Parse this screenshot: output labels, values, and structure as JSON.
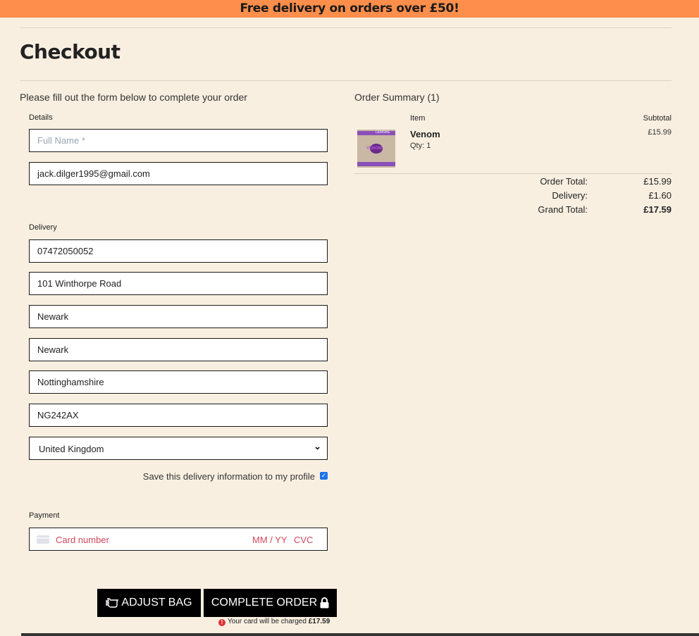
{
  "banner": {
    "text": "Free delivery on orders over £50!"
  },
  "page": {
    "title": "Checkout",
    "intro": "Please fill out the form below to complete your order"
  },
  "details": {
    "label": "Details",
    "full_name": {
      "value": "",
      "placeholder": "Full Name *"
    },
    "email": {
      "value": "jack.dilger1995@gmail.com"
    }
  },
  "delivery": {
    "label": "Delivery",
    "phone": "07472050052",
    "street": "101 Winthorpe Road",
    "town": "Newark",
    "city": "Newark",
    "county": "Nottinghamshire",
    "postcode": "NG242AX",
    "country": "United Kingdom",
    "save_label": "Save this delivery information to my profile",
    "save_checked": true
  },
  "payment": {
    "label": "Payment",
    "card_placeholder": "Card number",
    "expiry_placeholder": "MM / YY",
    "cvc_placeholder": "CVC"
  },
  "buttons": {
    "adjust_bag": "ADJUST BAG",
    "complete_order": "COMPLETE ORDER"
  },
  "charge_note": {
    "prefix": "Your card will be charged",
    "amount": "£17.59"
  },
  "summary": {
    "heading": "Order Summary (1)",
    "col_item": "Item",
    "col_subtotal": "Subtotal",
    "items": [
      {
        "name": "Venom",
        "qty": "Qty: 1",
        "subtotal": "£15.99",
        "thumb_text": "LEMSKE",
        "thumb_title": "VENOM"
      }
    ],
    "order_total_label": "Order Total:",
    "order_total": "£15.99",
    "delivery_label": "Delivery:",
    "delivery": "£1.60",
    "grand_total_label": "Grand Total:",
    "grand_total": "£17.59"
  },
  "icons": {
    "adjust": "back-hand-icon",
    "complete": "lock-icon",
    "warning": "warning-icon",
    "card": "credit-card-icon",
    "chevron": "chevron-down-icon"
  },
  "colors": {
    "banner": "#fe8e4b",
    "background": "#f9efe1",
    "button": "#000000",
    "error_text": "#d1485b"
  }
}
